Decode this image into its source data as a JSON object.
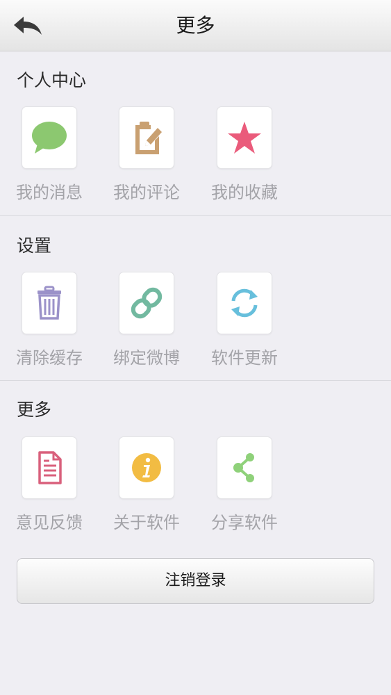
{
  "header": {
    "title": "更多",
    "back_icon": "back-arrow-icon"
  },
  "sections": [
    {
      "title": "个人中心",
      "items": [
        {
          "label": "我的消息",
          "icon": "message-bubble-icon",
          "color": "#8cc870"
        },
        {
          "label": "我的评论",
          "icon": "edit-note-icon",
          "color": "#c9a071"
        },
        {
          "label": "我的收藏",
          "icon": "star-icon",
          "color": "#ea5b7b"
        }
      ]
    },
    {
      "title": "设置",
      "items": [
        {
          "label": "清除缓存",
          "icon": "trash-icon",
          "color": "#9b92c9"
        },
        {
          "label": "绑定微博",
          "icon": "link-chain-icon",
          "color": "#72b9a0"
        },
        {
          "label": "软件更新",
          "icon": "refresh-icon",
          "color": "#67bfdc"
        }
      ]
    },
    {
      "title": "更多",
      "items": [
        {
          "label": "意见反馈",
          "icon": "document-icon",
          "color": "#d9607c"
        },
        {
          "label": "关于软件",
          "icon": "info-icon",
          "color": "#f2bc43"
        },
        {
          "label": "分享软件",
          "icon": "share-icon",
          "color": "#8fd17a"
        }
      ]
    }
  ],
  "logout": {
    "label": "注销登录"
  }
}
